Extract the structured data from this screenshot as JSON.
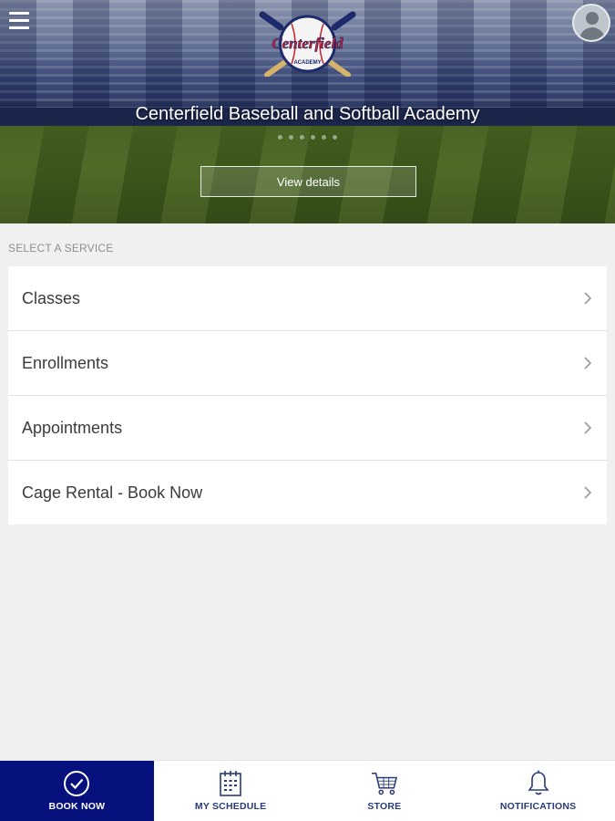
{
  "hero": {
    "logo_text": "Centerfield",
    "logo_subtext": "ACADEMY",
    "title": "Centerfield Baseball and Softball Academy",
    "details_button": "View details"
  },
  "services": {
    "section_label": "SELECT A SERVICE",
    "items": [
      {
        "label": "Classes"
      },
      {
        "label": "Enrollments"
      },
      {
        "label": "Appointments"
      },
      {
        "label": "Cage Rental - Book Now"
      }
    ]
  },
  "bottom_nav": {
    "active_color": "#07117d",
    "items": [
      {
        "label": "BOOK NOW",
        "icon": "check-circle-icon",
        "active": true
      },
      {
        "label": "MY SCHEDULE",
        "icon": "calendar-icon",
        "active": false
      },
      {
        "label": "STORE",
        "icon": "cart-icon",
        "active": false
      },
      {
        "label": "NOTIFICATIONS",
        "icon": "bell-icon",
        "active": false
      }
    ]
  }
}
